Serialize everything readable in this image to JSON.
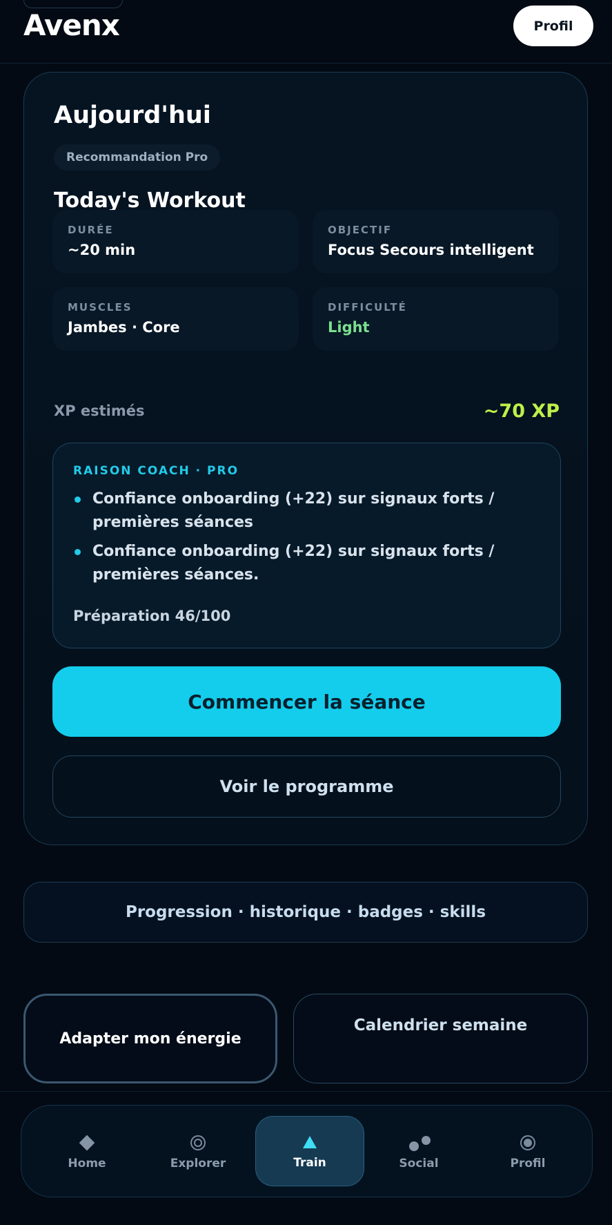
{
  "header": {
    "brand": "Avenx",
    "profile_button": "Profil"
  },
  "today": {
    "title": "Aujourd'hui",
    "badge": "Recommandation Pro",
    "workout_title": "Today's Workout",
    "stats": [
      {
        "label": "DURÉE",
        "value": "~20 min"
      },
      {
        "label": "OBJECTIF",
        "value": "Focus Secours intelligent"
      },
      {
        "label": "MUSCLES",
        "value": "Jambes · Core"
      },
      {
        "label": "DIFFICULTÉ",
        "value": "Light"
      }
    ],
    "xp_label": "XP estimés",
    "xp_value": "~70 XP",
    "reason": {
      "title": "RAISON COACH · PRO",
      "items": [
        "Confiance onboarding (+22) sur signaux forts / premières séances",
        "Confiance onboarding (+22) sur signaux forts / premières séances."
      ],
      "footer": "Préparation 46/100"
    },
    "start_button": "Commencer la séance",
    "program_button": "Voir le programme"
  },
  "progress_link": "Progression · historique · badges · skills",
  "actions": {
    "energy": "Adapter mon énergie",
    "calendar": "Calendrier semaine"
  },
  "nav": {
    "active": "Train",
    "items": [
      {
        "label": "Home",
        "icon": "home-icon"
      },
      {
        "label": "Explorer",
        "icon": "explorer-icon"
      },
      {
        "label": "Train",
        "icon": "train-icon"
      },
      {
        "label": "Social",
        "icon": "social-icon"
      },
      {
        "label": "Profil",
        "icon": "profile-icon"
      }
    ]
  },
  "colors": {
    "accent": "#14cdec",
    "xp": "#bdf04a",
    "difficulty_light": "#7be08e",
    "background": "#030a13"
  }
}
